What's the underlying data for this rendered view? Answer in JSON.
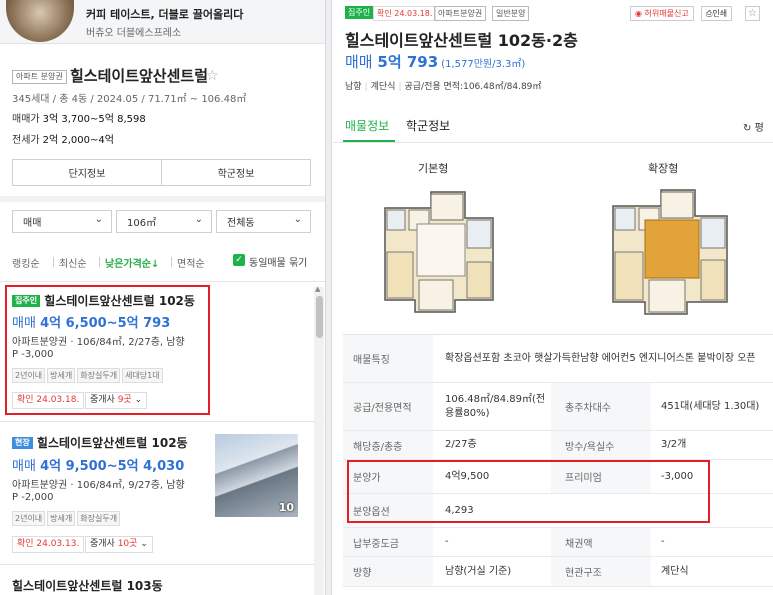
{
  "ad": {
    "title": "커피 테이스트, 더블로 끌어올리다",
    "subtitle": "버츄오 더블에스프레소"
  },
  "complex": {
    "badge": "아파트 분양권",
    "name": "힐스테이트앞산센트럴",
    "meta": "345세대 / 총 4동 / 2024.05 / 71.71㎡ ~ 106.48㎡",
    "sale_label": "매매가",
    "sale_value": "3억 3,700~5억 8,598",
    "jeonse_label": "전세가",
    "jeonse_value": "2억 2,000~4억",
    "btn_info": "단지정보",
    "btn_school": "학군정보"
  },
  "filters": {
    "trade": "매매",
    "area": "106㎡",
    "dong": "전체동"
  },
  "sort": {
    "ranking": "랭킹순",
    "latest": "최신순",
    "low_price": "낮은가격순↓",
    "area": "면적순",
    "group": "동일매물 묶기"
  },
  "listings": [
    {
      "tag": "집주인",
      "name": "힐스테이트앞산센트럴 102동",
      "price_kind": "매매",
      "price": "4억 6,500~5억 793",
      "desc": "아파트분양권 · 106/84㎡, 2/27층, 남향",
      "premium": "P -3,000",
      "chips": [
        "2년이내",
        "방세개",
        "화장실두개",
        "세대당1대"
      ],
      "confirm": "확인 24.03.18.",
      "agent_pre": "중개사 ",
      "agent_count": "9곳"
    },
    {
      "tag": "현장",
      "name": "힐스테이트앞산센트럴 102동",
      "price_kind": "매매",
      "price": "4억 9,500~5억 4,030",
      "desc": "아파트분양권 · 106/84㎡, 9/27층, 남향",
      "premium": "P -2,000",
      "chips": [
        "2년이내",
        "방세개",
        "화장실두개"
      ],
      "confirm": "확인 24.03.13.",
      "agent_pre": "중개사 ",
      "agent_count": "10곳",
      "photo_count": "10"
    },
    {
      "name": "힐스테이트앞산센트럴 103동"
    }
  ],
  "detail": {
    "tag_owner": "집주인",
    "tag_confirm": "확인 24.03.18.",
    "tag_type1": "아파트분양권",
    "tag_type2": "일반분양",
    "report": "허위매물신고",
    "print": "인쇄",
    "title": "힐스테이트앞산센트럴 102동·2층",
    "price_kind": "매매",
    "price": "5억 793",
    "price_per": "(1,577만원/3.3㎡)",
    "info_dir": "남향",
    "info_struct": "계단식",
    "info_area": "공급/전용 면적:106.48㎡/84.89㎡",
    "tab_info": "매물정보",
    "tab_school": "학군정보",
    "refresh": "평",
    "plan_basic": "기본형",
    "plan_ext": "확장형",
    "rows": [
      {
        "label": "매물특징",
        "value": "확장옵션포함 초코아 햇살가득한남향 에어컨5 엔지니어스톤 붙박이장 오픈"
      },
      {
        "label": "공급/전용면적",
        "value": "106.48㎡/84.89㎡(전용률80%)",
        "label2": "총주차대수",
        "value2": "451대(세대당 1.30대)"
      },
      {
        "label": "해당층/총층",
        "value": "2/27층",
        "label2": "방수/욕실수",
        "value2": "3/2개"
      },
      {
        "label": "분양가",
        "value": "4억9,500",
        "label2": "프리미엄",
        "value2": "-3,000"
      },
      {
        "label": "분양옵션",
        "value": "4,293"
      },
      {
        "label": "납부중도금",
        "value": "-",
        "label2": "채권액",
        "value2": "-"
      },
      {
        "label": "방향",
        "value": "남향(거실 기준)",
        "label2": "현관구조",
        "value2": "계단식"
      }
    ]
  }
}
